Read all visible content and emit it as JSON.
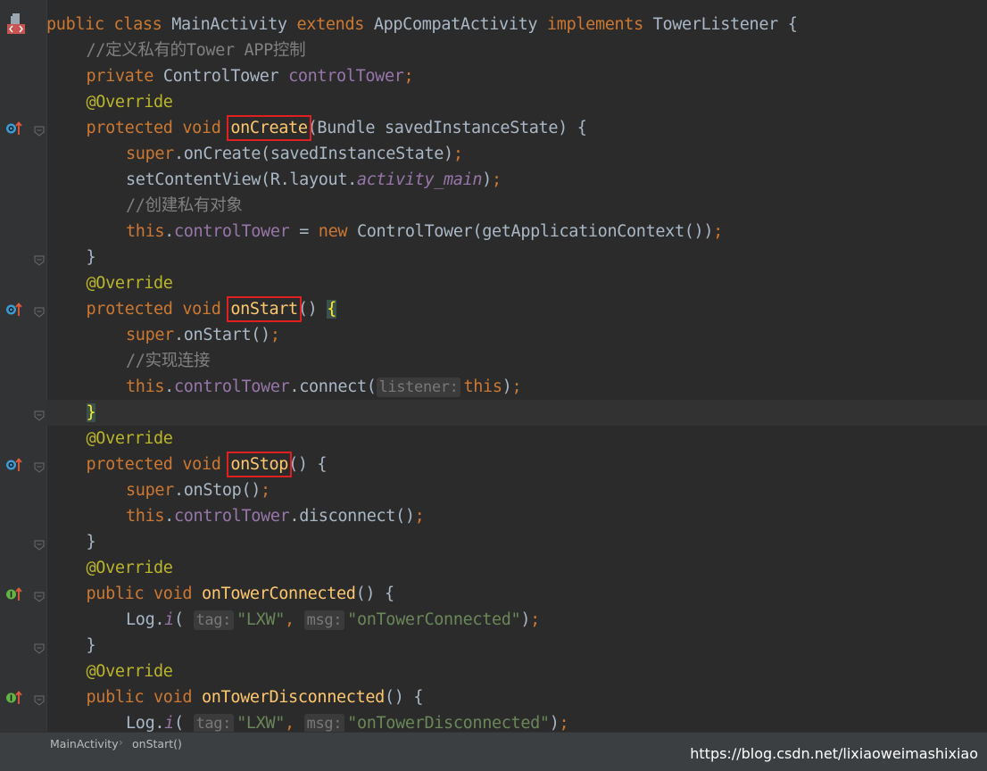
{
  "editor": {
    "lines": [
      {
        "indent": 0,
        "tokens": [
          {
            "t": "public class ",
            "c": "kw"
          },
          {
            "t": "MainActivity ",
            "c": "plain"
          },
          {
            "t": "extends ",
            "c": "kw"
          },
          {
            "t": "AppCompatActivity ",
            "c": "plain"
          },
          {
            "t": "implements ",
            "c": "kw"
          },
          {
            "t": "TowerListener {",
            "c": "plain"
          }
        ]
      },
      {
        "indent": 1,
        "tokens": [
          {
            "t": "//定义私有的Tower APP控制",
            "c": "cmt"
          }
        ]
      },
      {
        "indent": 1,
        "tokens": [
          {
            "t": "private ",
            "c": "kw"
          },
          {
            "t": "ControlTower ",
            "c": "plain"
          },
          {
            "t": "controlTower",
            "c": "fld"
          },
          {
            "t": ";",
            "c": "kw"
          }
        ]
      },
      {
        "indent": 1,
        "tokens": [
          {
            "t": "@Override",
            "c": "ann"
          }
        ]
      },
      {
        "indent": 1,
        "tokens": [
          {
            "t": "protected void ",
            "c": "kw"
          },
          {
            "t": "onCreate",
            "c": "meth",
            "box": true
          },
          {
            "t": "(Bundle savedInstanceState) {",
            "c": "plain"
          }
        ]
      },
      {
        "indent": 2,
        "tokens": [
          {
            "t": "super",
            "c": "kw"
          },
          {
            "t": ".onCreate(savedInstanceState)",
            "c": "plain"
          },
          {
            "t": ";",
            "c": "kw"
          }
        ]
      },
      {
        "indent": 2,
        "tokens": [
          {
            "t": "setContentView(R.layout.",
            "c": "plain"
          },
          {
            "t": "activity_main",
            "c": "ital"
          },
          {
            "t": ")",
            "c": "plain"
          },
          {
            "t": ";",
            "c": "kw"
          }
        ]
      },
      {
        "indent": 2,
        "tokens": [
          {
            "t": "//创建私有对象",
            "c": "cmt"
          }
        ]
      },
      {
        "indent": 2,
        "tokens": [
          {
            "t": "this",
            "c": "kw"
          },
          {
            "t": ".",
            "c": "plain"
          },
          {
            "t": "controlTower",
            "c": "fld"
          },
          {
            "t": " = ",
            "c": "plain"
          },
          {
            "t": "new ",
            "c": "kw"
          },
          {
            "t": "ControlTower(getApplicationContext())",
            "c": "plain"
          },
          {
            "t": ";",
            "c": "kw"
          }
        ]
      },
      {
        "indent": 1,
        "tokens": [
          {
            "t": "}",
            "c": "plain"
          }
        ]
      },
      {
        "indent": 1,
        "tokens": [
          {
            "t": "@Override",
            "c": "ann"
          }
        ]
      },
      {
        "indent": 1,
        "tokens": [
          {
            "t": "protected void ",
            "c": "kw"
          },
          {
            "t": "onStart",
            "c": "meth",
            "box": true
          },
          {
            "t": "() ",
            "c": "plain"
          },
          {
            "t": "{",
            "c": "plain",
            "match": true
          }
        ]
      },
      {
        "indent": 2,
        "tokens": [
          {
            "t": "super",
            "c": "kw"
          },
          {
            "t": ".onStart()",
            "c": "plain"
          },
          {
            "t": ";",
            "c": "kw"
          }
        ]
      },
      {
        "indent": 2,
        "tokens": [
          {
            "t": "//实现连接",
            "c": "cmt"
          }
        ]
      },
      {
        "indent": 2,
        "tokens": [
          {
            "t": "this",
            "c": "kw"
          },
          {
            "t": ".",
            "c": "plain"
          },
          {
            "t": "controlTower",
            "c": "fld"
          },
          {
            "t": ".connect(",
            "c": "plain"
          },
          {
            "t": "listener:",
            "c": "hint"
          },
          {
            "t": "this",
            "c": "kw"
          },
          {
            "t": ")",
            "c": "plain"
          },
          {
            "t": ";",
            "c": "kw"
          }
        ]
      },
      {
        "indent": 1,
        "caret": true,
        "tokens": [
          {
            "t": "}",
            "c": "plain",
            "match": true
          }
        ]
      },
      {
        "indent": 1,
        "tokens": [
          {
            "t": "@Override",
            "c": "ann"
          }
        ]
      },
      {
        "indent": 1,
        "tokens": [
          {
            "t": "protected void ",
            "c": "kw"
          },
          {
            "t": "onStop",
            "c": "meth",
            "box": true
          },
          {
            "t": "() {",
            "c": "plain"
          }
        ]
      },
      {
        "indent": 2,
        "tokens": [
          {
            "t": "super",
            "c": "kw"
          },
          {
            "t": ".onStop()",
            "c": "plain"
          },
          {
            "t": ";",
            "c": "kw"
          }
        ]
      },
      {
        "indent": 2,
        "tokens": [
          {
            "t": "this",
            "c": "kw"
          },
          {
            "t": ".",
            "c": "plain"
          },
          {
            "t": "controlTower",
            "c": "fld"
          },
          {
            "t": ".disconnect()",
            "c": "plain"
          },
          {
            "t": ";",
            "c": "kw"
          }
        ]
      },
      {
        "indent": 1,
        "tokens": [
          {
            "t": "}",
            "c": "plain"
          }
        ]
      },
      {
        "indent": 1,
        "tokens": [
          {
            "t": "@Override",
            "c": "ann"
          }
        ]
      },
      {
        "indent": 1,
        "tokens": [
          {
            "t": "public void ",
            "c": "kw"
          },
          {
            "t": "onTowerConnected",
            "c": "meth"
          },
          {
            "t": "() {",
            "c": "plain"
          }
        ]
      },
      {
        "indent": 2,
        "tokens": [
          {
            "t": "Log.",
            "c": "plain"
          },
          {
            "t": "i",
            "c": "ital"
          },
          {
            "t": "( ",
            "c": "plain"
          },
          {
            "t": "tag:",
            "c": "hint"
          },
          {
            "t": "\"LXW\"",
            "c": "str"
          },
          {
            "t": ", ",
            "c": "kw"
          },
          {
            "t": "msg:",
            "c": "hint"
          },
          {
            "t": "\"onTowerConnected\"",
            "c": "str"
          },
          {
            "t": ")",
            "c": "plain"
          },
          {
            "t": ";",
            "c": "kw"
          }
        ]
      },
      {
        "indent": 1,
        "tokens": [
          {
            "t": "}",
            "c": "plain"
          }
        ]
      },
      {
        "indent": 1,
        "tokens": [
          {
            "t": "@Override",
            "c": "ann"
          }
        ]
      },
      {
        "indent": 1,
        "tokens": [
          {
            "t": "public void ",
            "c": "kw"
          },
          {
            "t": "onTowerDisconnected",
            "c": "meth"
          },
          {
            "t": "() {",
            "c": "plain"
          }
        ]
      },
      {
        "indent": 2,
        "tokens": [
          {
            "t": "Log.",
            "c": "plain"
          },
          {
            "t": "i",
            "c": "ital"
          },
          {
            "t": "( ",
            "c": "plain"
          },
          {
            "t": "tag:",
            "c": "hint"
          },
          {
            "t": "\"LXW\"",
            "c": "str"
          },
          {
            "t": ", ",
            "c": "kw"
          },
          {
            "t": "msg:",
            "c": "hint"
          },
          {
            "t": "\"onTowerDisconnected\"",
            "c": "str"
          },
          {
            "t": ")",
            "c": "plain"
          },
          {
            "t": ";",
            "c": "kw"
          }
        ]
      }
    ]
  },
  "gutter": {
    "override_marker_lines": [
      4,
      11,
      17
    ],
    "implement_marker_lines": [
      22,
      26
    ],
    "fold_lines": [
      4,
      9,
      11,
      15,
      17,
      20,
      22,
      24,
      26
    ],
    "class_icon": "android-class-icon"
  },
  "breadcrumb": {
    "items": [
      "MainActivity",
      "onStart()"
    ],
    "separator": "›"
  },
  "watermark": "https://blog.csdn.net/lixiaoweimashixiao",
  "colors": {
    "background": "#2b2b2b",
    "gutter": "#313335",
    "keyword": "#cc7832",
    "annotation": "#bbb529",
    "field": "#9876aa",
    "method": "#ffc66d",
    "string": "#6a8759",
    "comment": "#808080",
    "text": "#a9b7c6",
    "highlight_box": "#e02020"
  }
}
